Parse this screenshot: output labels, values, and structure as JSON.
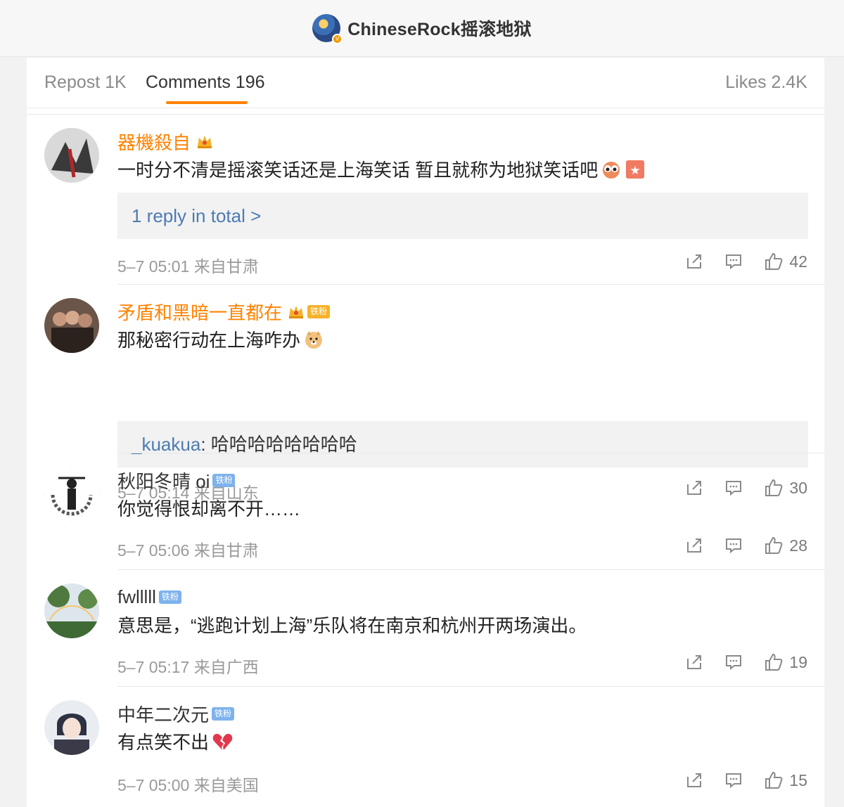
{
  "header": {
    "title": "ChineseRock摇滚地狱",
    "verified_badge": "V"
  },
  "tabs": {
    "repost": "Repost 1K",
    "comments": "Comments 196",
    "likes": "Likes 2.4K",
    "active": "comments",
    "accent": "#ff8200"
  },
  "comments": [
    {
      "name": "器機殺自",
      "name_color": "#ff8200",
      "badges": [],
      "text": "一时分不清是摇滚笑话还是上海笑话 暂且就称为地狱笑话吧",
      "emojis": [
        "eyes-emoji-icon",
        "zan-emoji-icon"
      ],
      "reply_link": "1 reply in total >",
      "meta": "5–7 05:01 来自甘肃",
      "likes": "42"
    },
    {
      "name": "矛盾和黑暗一直都在",
      "name_color": "#ff8200",
      "badges": [
        "铁粉"
      ],
      "text": "那秘密行动在上海咋办",
      "emojis": [
        "doge-emoji-icon"
      ],
      "reply_user": "_kuakua",
      "reply_text": ": 哈哈哈哈哈哈哈哈",
      "meta": "5–7 05:14 来自山东",
      "likes": "30"
    },
    {
      "name": "秋阳冬晴 oi",
      "name_color": "#333333",
      "badges": [
        "铁粉"
      ],
      "text": "你觉得恨却离不开……",
      "meta": "5–7 05:06 来自甘肃",
      "likes": "28"
    },
    {
      "name": "fwlllll",
      "name_color": "#333333",
      "badges": [
        "铁粉"
      ],
      "text": "意思是，“逃跑计划上海”乐队将在南京和杭州开两场演出。",
      "meta": "5–7 05:17 来自广西",
      "likes": "19"
    },
    {
      "name": "中年二次元",
      "name_color": "#333333",
      "badges": [
        "铁粉"
      ],
      "text": "有点笑不出",
      "emojis": [
        "broken-heart-emoji-icon"
      ],
      "meta": "5–7 05:00 来自美国",
      "likes": "15"
    }
  ]
}
